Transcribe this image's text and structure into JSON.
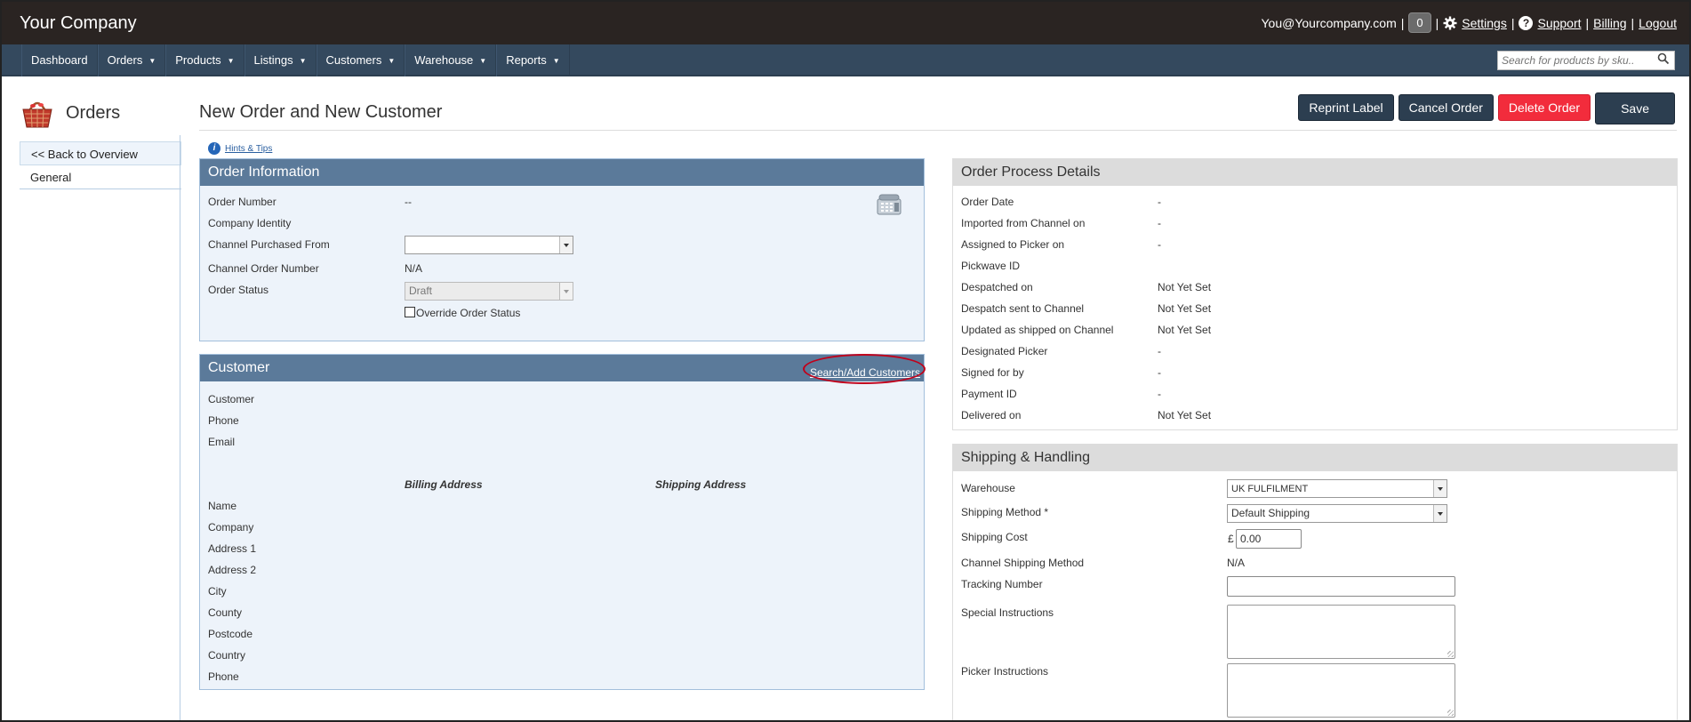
{
  "topbar": {
    "brand": "Your Company",
    "email": "You@Yourcompany.com",
    "notification_count": "0",
    "settings": "Settings",
    "support": "Support",
    "billing": "Billing",
    "logout": "Logout",
    "sep": "|"
  },
  "nav": {
    "items": [
      "Dashboard",
      "Orders",
      "Products",
      "Listings",
      "Customers",
      "Warehouse",
      "Reports"
    ],
    "search_placeholder": "Search for products by sku.."
  },
  "sidebar": {
    "title": "Orders",
    "back": "<< Back to Overview",
    "general": "General"
  },
  "header": {
    "title": "New Order and New Customer",
    "reprint": "Reprint Label",
    "cancel": "Cancel Order",
    "delete": "Delete Order",
    "save": "Save",
    "hints": "Hints & Tips"
  },
  "order_info": {
    "title": "Order Information",
    "order_number_label": "Order Number",
    "order_number": "--",
    "company_identity_label": "Company Identity",
    "channel_label": "Channel Purchased From",
    "channel_value": "",
    "channel_order_number_label": "Channel Order Number",
    "channel_order_number": "N/A",
    "order_status_label": "Order Status",
    "order_status": "Draft",
    "override_label": "Override Order Status"
  },
  "customer": {
    "title": "Customer",
    "search_add": "Search/Add Customers",
    "fields": [
      "Customer",
      "Phone",
      "Email"
    ],
    "billing_head": "Billing Address",
    "shipping_head": "Shipping Address",
    "address_fields": [
      "Name",
      "Company",
      "Address 1",
      "Address 2",
      "City",
      "County",
      "Postcode",
      "Country",
      "Phone"
    ]
  },
  "process": {
    "title": "Order Process Details",
    "rows": [
      {
        "label": "Order Date",
        "value": "-"
      },
      {
        "label": "Imported from Channel on",
        "value": "-"
      },
      {
        "label": "Assigned to Picker on",
        "value": "-"
      },
      {
        "label": "Pickwave ID",
        "value": ""
      },
      {
        "label": "Despatched on",
        "value": "Not Yet Set"
      },
      {
        "label": "Despatch sent to Channel",
        "value": "Not Yet Set"
      },
      {
        "label": "Updated as shipped on Channel",
        "value": "Not Yet Set"
      },
      {
        "label": "Designated Picker",
        "value": "-"
      },
      {
        "label": "Signed for by",
        "value": "-"
      },
      {
        "label": "Payment ID",
        "value": "-"
      },
      {
        "label": "Delivered on",
        "value": "Not Yet Set"
      }
    ]
  },
  "shipping": {
    "title": "Shipping & Handling",
    "warehouse_label": "Warehouse",
    "warehouse": "UK FULFILMENT",
    "method_label": "Shipping Method *",
    "method": "Default Shipping",
    "cost_label": "Shipping Cost",
    "currency": "£",
    "cost": "0.00",
    "channel_method_label": "Channel Shipping Method",
    "channel_method": "N/A",
    "tracking_label": "Tracking Number",
    "tracking": "",
    "special_label": "Special Instructions",
    "picker_label": "Picker Instructions"
  }
}
